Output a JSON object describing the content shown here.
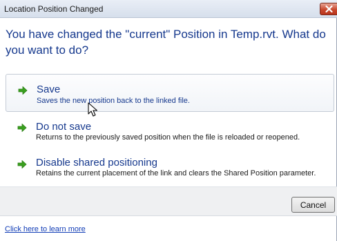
{
  "window": {
    "title": "Location Position Changed",
    "close_icon": "close-icon"
  },
  "heading": "You have changed the \"current\" Position in Temp.rvt.  What do you want to do?",
  "options": [
    {
      "label": "Save",
      "description": "Saves the new position back to the linked file.",
      "icon": "green-arrow-icon",
      "highlighted": true
    },
    {
      "label": "Do not save",
      "description": "Returns to the previously saved position when the file is reloaded or reopened.",
      "icon": "green-arrow-icon",
      "highlighted": false
    },
    {
      "label": "Disable shared positioning",
      "description": "Retains the current placement of the link and clears the Shared Position parameter.",
      "icon": "green-arrow-icon",
      "highlighted": false
    }
  ],
  "buttons": {
    "cancel_label": "Cancel"
  },
  "footer": {
    "learn_more_link": "Click here to learn more"
  },
  "colors": {
    "heading_blue": "#15388d",
    "arrow_green": "#3aa01f",
    "close_red": "#c9492f",
    "link_blue": "#0f3bb6"
  }
}
